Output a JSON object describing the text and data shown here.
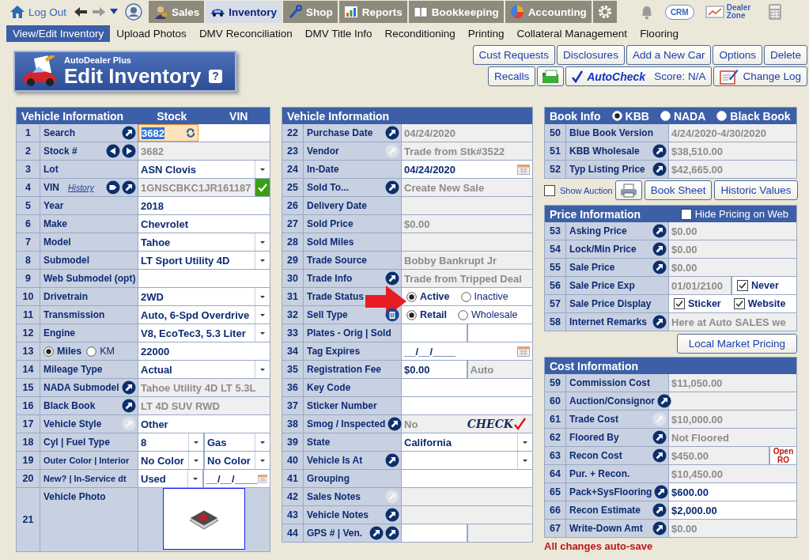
{
  "topnav": {
    "logout": "Log Out",
    "tabs": [
      {
        "label": "Sales",
        "kind": "person",
        "selected": false
      },
      {
        "label": "Inventory",
        "kind": "car",
        "selected": true
      },
      {
        "label": "Shop",
        "kind": "wrench",
        "selected": false
      },
      {
        "label": "Reports",
        "kind": "chart",
        "selected": false
      },
      {
        "label": "Bookkeeping",
        "kind": "book",
        "selected": false
      },
      {
        "label": "Accounting",
        "kind": "pie",
        "selected": false
      }
    ],
    "crm": "CRM",
    "dealer_zone": "Dealer Zone"
  },
  "subnav": [
    {
      "label": "View/Edit Inventory",
      "selected": true
    },
    {
      "label": "Upload Photos",
      "selected": false
    },
    {
      "label": "DMV Reconciliation",
      "selected": false
    },
    {
      "label": "DMV Title Info",
      "selected": false
    },
    {
      "label": "Reconditioning",
      "selected": false
    },
    {
      "label": "Printing",
      "selected": false
    },
    {
      "label": "Collateral Management",
      "selected": false
    },
    {
      "label": "Flooring",
      "selected": false
    }
  ],
  "header": {
    "brand": "AutoDealer Plus",
    "title": "Edit Inventory",
    "help": "?"
  },
  "actions": {
    "row1": [
      "Cust Requests",
      "Disclosures",
      "Add a New Car",
      "Options",
      "Delete"
    ],
    "row2": [
      {
        "kind": "text",
        "label": "Recalls"
      },
      {
        "kind": "folder"
      },
      {
        "kind": "autocheck",
        "label": "AutoCheck",
        "score": "Score:  N/A"
      },
      {
        "kind": "log",
        "label": "Change Log"
      }
    ]
  },
  "vehicle_left": {
    "columns": [
      "Vehicle Information",
      "Stock",
      "VIN"
    ],
    "rows": [
      {
        "num": "1",
        "label": "Search",
        "buttons": [
          {
            "kind": "arrow",
            "disabled": false
          }
        ],
        "cells": [
          {
            "kind": "search",
            "value": "3682"
          }
        ]
      },
      {
        "num": "2",
        "label": "Stock #",
        "buttons": [
          {
            "kind": "left",
            "disabled": false
          },
          {
            "kind": "right",
            "disabled": false
          }
        ],
        "cells": [
          {
            "kind": "text",
            "value": "3682",
            "editable": false
          }
        ]
      },
      {
        "num": "3",
        "label": "Lot",
        "cells": [
          {
            "kind": "select",
            "value": "ASN Clovis"
          }
        ]
      },
      {
        "num": "4",
        "label": "VIN",
        "link": "History",
        "buttons": [
          {
            "kind": "tag",
            "disabled": false
          },
          {
            "kind": "arrow",
            "disabled": false
          }
        ],
        "cells": [
          {
            "kind": "text",
            "value": "1GNSCBKC1JR161187",
            "editable": false,
            "verified": true
          }
        ]
      },
      {
        "num": "5",
        "label": "Year",
        "cells": [
          {
            "kind": "text",
            "value": "2018",
            "editable": true
          }
        ]
      },
      {
        "num": "6",
        "label": "Make",
        "cells": [
          {
            "kind": "text",
            "value": "Chevrolet",
            "editable": true
          }
        ]
      },
      {
        "num": "7",
        "label": "Model",
        "cells": [
          {
            "kind": "select",
            "value": "Tahoe"
          }
        ]
      },
      {
        "num": "8",
        "label": "Submodel",
        "cells": [
          {
            "kind": "select",
            "value": "LT Sport Utility 4D"
          }
        ]
      },
      {
        "num": "9",
        "label": "Web Submodel (opt)",
        "cells": [
          {
            "kind": "text",
            "editable": true
          }
        ]
      },
      {
        "num": "10",
        "label": "Drivetrain",
        "cells": [
          {
            "kind": "select",
            "value": "2WD"
          }
        ]
      },
      {
        "num": "11",
        "label": "Transmission",
        "cells": [
          {
            "kind": "select",
            "value": "Auto, 6-Spd Overdrive"
          }
        ]
      },
      {
        "num": "12",
        "label": "Engine",
        "cells": [
          {
            "kind": "select",
            "value": "V8, EcoTec3, 5.3 Liter"
          }
        ]
      },
      {
        "num": "13",
        "label_options": [
          {
            "label": "Miles",
            "selected": true
          },
          {
            "label": "KM",
            "selected": false
          }
        ],
        "cells": [
          {
            "kind": "text",
            "value": "22000",
            "editable": true
          }
        ]
      },
      {
        "num": "14",
        "label": "Mileage Type",
        "cells": [
          {
            "kind": "select",
            "value": "Actual"
          }
        ]
      },
      {
        "num": "15",
        "label": "NADA Submodel",
        "buttons": [
          {
            "kind": "arrow",
            "disabled": false
          }
        ],
        "cells": [
          {
            "kind": "text",
            "value": "Tahoe Utility 4D LT 5.3L",
            "editable": false
          }
        ]
      },
      {
        "num": "16",
        "label": "Black Book",
        "buttons": [
          {
            "kind": "arrow",
            "disabled": false
          }
        ],
        "cells": [
          {
            "kind": "text",
            "value": "LT 4D SUV RWD",
            "editable": false
          }
        ]
      },
      {
        "num": "17",
        "label": "Vehicle Style",
        "buttons": [
          {
            "kind": "arrow",
            "disabled": true
          }
        ],
        "cells": [
          {
            "kind": "text",
            "value": "Other",
            "editable": true
          }
        ]
      },
      {
        "num": "18",
        "label": "Cyl | Fuel Type",
        "cells": [
          {
            "kind": "select",
            "value": "8"
          },
          {
            "kind": "select",
            "value": "Gas"
          }
        ]
      },
      {
        "num": "19",
        "label": "Outer Color | Interior",
        "compact": true,
        "cells": [
          {
            "kind": "select",
            "value": "No Color"
          },
          {
            "kind": "select",
            "value": "No Color"
          }
        ]
      },
      {
        "num": "20",
        "label": "New? | In-Service dt",
        "compact": true,
        "cells": [
          {
            "kind": "select",
            "value": "Used"
          },
          {
            "kind": "date",
            "value": "__/__/____",
            "editable": true
          }
        ]
      },
      {
        "num": "21",
        "label": "Vehicle Photo",
        "cells": [
          {
            "kind": "photo"
          }
        ]
      }
    ]
  },
  "vehicle_middle": {
    "columns": [
      "Vehicle Information"
    ],
    "rows": [
      {
        "num": "22",
        "label": "Purchase Date",
        "buttons": [
          {
            "kind": "arrow",
            "disabled": false
          }
        ],
        "cells": [
          {
            "kind": "text",
            "value": "04/24/2020",
            "editable": false
          }
        ]
      },
      {
        "num": "23",
        "label": "Vendor",
        "buttons": [
          {
            "kind": "arrow",
            "disabled": true
          }
        ],
        "cells": [
          {
            "kind": "text",
            "value": "Trade from  Stk#3522",
            "editable": false
          }
        ]
      },
      {
        "num": "24",
        "label": "In-Date",
        "cells": [
          {
            "kind": "date",
            "value": "04/24/2020",
            "editable": true
          }
        ]
      },
      {
        "num": "25",
        "label": "Sold To...",
        "buttons": [
          {
            "kind": "arrow",
            "disabled": false
          }
        ],
        "cells": [
          {
            "kind": "text",
            "value": "Create New Sale",
            "editable": false
          }
        ]
      },
      {
        "num": "26",
        "label": "Delivery Date",
        "cells": [
          {
            "kind": "text",
            "editable": false
          }
        ]
      },
      {
        "num": "27",
        "label": "Sold Price",
        "cells": [
          {
            "kind": "text",
            "value": "$0.00",
            "editable": false
          }
        ]
      },
      {
        "num": "28",
        "label": "Sold Miles",
        "cells": [
          {
            "kind": "text",
            "editable": false
          }
        ]
      },
      {
        "num": "29",
        "label": "Trade Source",
        "cells": [
          {
            "kind": "text",
            "value": "Bobby Bankrupt Jr",
            "editable": false
          }
        ]
      },
      {
        "num": "30",
        "label": "Trade Info",
        "buttons": [
          {
            "kind": "arrow",
            "disabled": false
          }
        ],
        "cells": [
          {
            "kind": "text",
            "value": "Trade from Tripped Deal",
            "editable": false
          }
        ]
      },
      {
        "num": "31",
        "label": "Trade Status",
        "pointer": true,
        "cells": [
          {
            "kind": "radio",
            "options": [
              {
                "label": "Active",
                "selected": true
              },
              {
                "label": "Inactive",
                "selected": false
              }
            ]
          }
        ]
      },
      {
        "num": "32",
        "label": "Sell Type",
        "buttons": [
          {
            "kind": "trash",
            "disabled": false
          }
        ],
        "cells": [
          {
            "kind": "radio",
            "options": [
              {
                "label": "Retail",
                "selected": true
              },
              {
                "label": "Wholesale",
                "selected": false
              }
            ]
          }
        ]
      },
      {
        "num": "33",
        "label": "Plates - Orig | Sold",
        "cells": [
          {
            "kind": "text",
            "editable": true
          },
          {
            "kind": "text",
            "editable": true
          }
        ]
      },
      {
        "num": "34",
        "label": "Tag Expires",
        "cells": [
          {
            "kind": "date",
            "value": "__/__/____",
            "editable": true
          }
        ]
      },
      {
        "num": "35",
        "label": "Registration Fee",
        "cells": [
          {
            "kind": "text",
            "value": "$0.00",
            "editable": true
          },
          {
            "kind": "text",
            "value": "Auto",
            "editable": false
          }
        ]
      },
      {
        "num": "36",
        "label": "Key Code",
        "cells": [
          {
            "kind": "text",
            "editable": true
          }
        ]
      },
      {
        "num": "37",
        "label": "Sticker Number",
        "cells": [
          {
            "kind": "text",
            "editable": true
          }
        ]
      },
      {
        "num": "38",
        "label": "Smog / Inspected",
        "buttons": [
          {
            "kind": "arrow",
            "disabled": false
          }
        ],
        "cells": [
          {
            "kind": "smog",
            "value": "No",
            "badge": "CHECK"
          }
        ]
      },
      {
        "num": "39",
        "label": "State",
        "cells": [
          {
            "kind": "select",
            "value": "California"
          }
        ]
      },
      {
        "num": "40",
        "label": "Vehicle Is At",
        "buttons": [
          {
            "kind": "arrow",
            "disabled": false
          }
        ],
        "cells": [
          {
            "kind": "select"
          }
        ]
      },
      {
        "num": "41",
        "label": "Grouping",
        "cells": [
          {
            "kind": "text",
            "editable": true
          }
        ]
      },
      {
        "num": "42",
        "label": "Sales Notes",
        "buttons": [
          {
            "kind": "arrow",
            "disabled": true
          }
        ],
        "cells": [
          {
            "kind": "text",
            "editable": false
          }
        ]
      },
      {
        "num": "43",
        "label": "Vehicle Notes",
        "buttons": [
          {
            "kind": "arrow",
            "disabled": false
          }
        ],
        "cells": [
          {
            "kind": "text",
            "editable": false
          }
        ]
      },
      {
        "num": "44",
        "label": "GPS # | Ven.",
        "buttons": [
          {
            "kind": "arrow",
            "disabled": false
          },
          {
            "kind": "arrow",
            "disabled": false
          }
        ],
        "cells": [
          {
            "kind": "text",
            "editable": true
          },
          {
            "kind": "text",
            "editable": false
          }
        ]
      }
    ]
  },
  "book_info": {
    "title": "Book Info",
    "sources": [
      {
        "label": "KBB",
        "selected": true
      },
      {
        "label": "NADA",
        "selected": false
      },
      {
        "label": "Black Book",
        "selected": false
      }
    ],
    "rows": [
      {
        "num": "50",
        "label": "Blue Book Version",
        "cells": [
          {
            "kind": "text",
            "value": "4/24/2020-4/30/2020",
            "editable": false
          }
        ]
      },
      {
        "num": "51",
        "label": "KBB Wholesale",
        "buttons": [
          {
            "kind": "arrow",
            "disabled": false
          }
        ],
        "cells": [
          {
            "kind": "text",
            "value": "$38,510.00",
            "editable": false
          }
        ]
      },
      {
        "num": "52",
        "label": "Typ Listing Price",
        "buttons": [
          {
            "kind": "arrow",
            "disabled": false
          }
        ],
        "cells": [
          {
            "kind": "text",
            "value": "$42,665.00",
            "editable": false
          }
        ]
      }
    ]
  },
  "book_tools": {
    "show_auction": {
      "label": "Show Auction",
      "checked": false
    },
    "buttons": [
      "Book Sheet",
      "Historic Values"
    ]
  },
  "price_info": {
    "title": "Price Information",
    "hide_pricing": {
      "label": "Hide Pricing on Web",
      "checked": false
    },
    "rows": [
      {
        "num": "53",
        "label": "Asking Price",
        "buttons": [
          {
            "kind": "arrow",
            "disabled": false
          }
        ],
        "cells": [
          {
            "kind": "text",
            "value": "$0.00",
            "editable": false
          }
        ]
      },
      {
        "num": "54",
        "label": "Lock/Min Price",
        "buttons": [
          {
            "kind": "arrow",
            "disabled": false
          }
        ],
        "cells": [
          {
            "kind": "text",
            "value": "$0.00",
            "editable": false
          }
        ]
      },
      {
        "num": "55",
        "label": "Sale Price",
        "buttons": [
          {
            "kind": "arrow",
            "disabled": false
          }
        ],
        "cells": [
          {
            "kind": "text",
            "value": "$0.00",
            "editable": false
          }
        ]
      },
      {
        "num": "56",
        "label": "Sale Price Exp",
        "cells": [
          {
            "kind": "text",
            "value": "01/01/2100",
            "editable": false
          },
          {
            "kind": "check",
            "options": [
              {
                "label": "Never",
                "checked": true
              }
            ]
          }
        ]
      },
      {
        "num": "57",
        "label": "Sale Price Display",
        "cells": [
          {
            "kind": "check",
            "options": [
              {
                "label": "Sticker",
                "checked": true
              },
              {
                "label": "Website",
                "checked": true
              }
            ]
          }
        ]
      },
      {
        "num": "58",
        "label": "Internet Remarks",
        "buttons": [
          {
            "kind": "arrow",
            "disabled": false
          }
        ],
        "cells": [
          {
            "kind": "text",
            "value": "Here at Auto SALES we",
            "editable": false
          }
        ]
      }
    ]
  },
  "market_button": "Local Market Pricing",
  "cost_info": {
    "title": "Cost Information",
    "rows": [
      {
        "num": "59",
        "label": "Commission Cost",
        "cells": [
          {
            "kind": "text",
            "value": "$11,050.00",
            "editable": false
          }
        ]
      },
      {
        "num": "60",
        "label": "Auction/Consignor",
        "buttons": [
          {
            "kind": "arrow",
            "disabled": false
          }
        ],
        "cells": [
          {
            "kind": "text",
            "editable": false
          }
        ]
      },
      {
        "num": "61",
        "label": "Trade Cost",
        "buttons": [
          {
            "kind": "arrow",
            "disabled": true
          }
        ],
        "cells": [
          {
            "kind": "text",
            "value": "$10,000.00",
            "editable": false
          }
        ]
      },
      {
        "num": "62",
        "label": "Floored By",
        "buttons": [
          {
            "kind": "arrow",
            "disabled": false
          }
        ],
        "cells": [
          {
            "kind": "text",
            "value": "Not Floored",
            "editable": false
          }
        ]
      },
      {
        "num": "63",
        "label": "Recon Cost",
        "buttons": [
          {
            "kind": "arrow",
            "disabled": false
          }
        ],
        "cells": [
          {
            "kind": "text",
            "value": "$450.00",
            "editable": false
          },
          {
            "kind": "note",
            "value": "Open RO"
          }
        ]
      },
      {
        "num": "64",
        "label": "Pur. + Recon.",
        "cells": [
          {
            "kind": "text",
            "value": "$10,450.00",
            "editable": false
          }
        ]
      },
      {
        "num": "65",
        "label": "Pack+SysFlooring",
        "buttons": [
          {
            "kind": "arrow",
            "disabled": false
          }
        ],
        "cells": [
          {
            "kind": "text",
            "value": "$600.00",
            "editable": true
          }
        ]
      },
      {
        "num": "66",
        "label": "Recon Estimate",
        "buttons": [
          {
            "kind": "arrow",
            "disabled": false
          }
        ],
        "cells": [
          {
            "kind": "text",
            "value": "$2,000.00",
            "editable": true
          }
        ]
      },
      {
        "num": "67",
        "label": "Write-Down Amt",
        "buttons": [
          {
            "kind": "arrow",
            "disabled": false
          }
        ],
        "cells": [
          {
            "kind": "text",
            "value": "$0.00",
            "editable": false
          }
        ]
      }
    ]
  },
  "footer": "All changes auto-save"
}
